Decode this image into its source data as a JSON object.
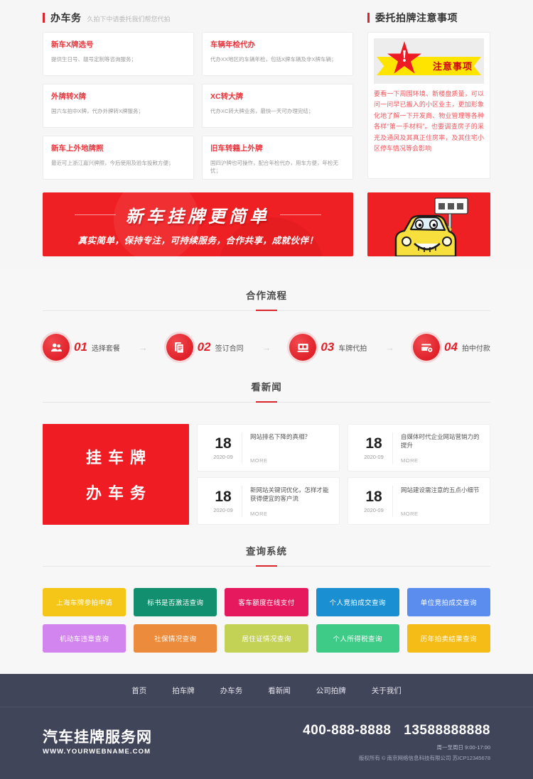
{
  "services": {
    "heading": "办车务",
    "subheading": "久拍下中请委托我们帮您代拍",
    "cards": [
      {
        "title": "新车X牌选号",
        "desc": "提供生日号、靓号定制等咨询服务；"
      },
      {
        "title": "车辆年检代办",
        "desc": "代办XX地区的车辆年检，包括X牌车辆及非X牌车辆；"
      },
      {
        "title": "外牌转X牌",
        "desc": "国六车拍中X牌，代办外牌转X牌服务；"
      },
      {
        "title": "XC转大牌",
        "desc": "代办XC转大牌业务，最快一天可办理完结；"
      },
      {
        "title": "新车上外地牌照",
        "desc": "最近可上浙江嘉兴牌照，今后使用及验车投敕方便；"
      },
      {
        "title": "旧车转籍上外牌",
        "desc": "国四沪牌也可操作，配合年检代办，用车方便，年检无忧；"
      }
    ]
  },
  "notice": {
    "heading": "委托拍牌注意事项",
    "banner_text": "注意事项",
    "banner_mark": "!",
    "body": "要看一下周围环境、新楼盘质量，可以问一问早已搬入的小区业主，更加形象化地了解一下开发商、物业管理等各种各样“第一手材料”。也要调查房子的采光及通风及其真正住房率，及其住宅小区停车情况等会影响"
  },
  "banner": {
    "title": "新车挂牌更简单",
    "subtitle": "真实简单，保持专注，可持续服务，合作共享，成就伙伴！",
    "side_icon": "cartoon-car-holding-plate"
  },
  "process": {
    "title": "合作流程",
    "arrow": "→",
    "steps": [
      {
        "num": "01",
        "label": "选择套餐",
        "icon": "users-icon"
      },
      {
        "num": "02",
        "label": "签订合同",
        "icon": "document-icon"
      },
      {
        "num": "03",
        "label": "车牌代拍",
        "icon": "license-plate-icon"
      },
      {
        "num": "04",
        "label": "拍中付款",
        "icon": "payment-card-icon"
      }
    ]
  },
  "news": {
    "title": "看新闻",
    "promo_line1": "挂车牌",
    "promo_line2": "办车务",
    "more_label": "MORE",
    "items": [
      {
        "day": "18",
        "month": "2020-09",
        "title": "网站排名下降的真相？"
      },
      {
        "day": "18",
        "month": "2020-09",
        "title": "新网站关键词优化，怎样才能获得便宜的客户流"
      },
      {
        "day": "18",
        "month": "2020-09",
        "title": "自媒体时代企业网站营销力的提升"
      },
      {
        "day": "18",
        "month": "2020-09",
        "title": "网站建设需注意的五点小细节"
      }
    ]
  },
  "query": {
    "title": "查询系统",
    "buttons": [
      {
        "label": "上海车牌参拍申请",
        "color": "#f5c518"
      },
      {
        "label": "标书是否激活查询",
        "color": "#128f6e"
      },
      {
        "label": "客车额度在线支付",
        "color": "#e6195e"
      },
      {
        "label": "个人竞拍成交查询",
        "color": "#1a8fd1"
      },
      {
        "label": "单位竞拍成交查询",
        "color": "#5b8def"
      },
      {
        "label": "机动车违章查询",
        "color": "#d284ef"
      },
      {
        "label": "社保情况查询",
        "color": "#ec8b3c"
      },
      {
        "label": "居住证情况查询",
        "color": "#c3d254"
      },
      {
        "label": "个人所得税查询",
        "color": "#3ecb87"
      },
      {
        "label": "历年拍卖结果查询",
        "color": "#f5bc18"
      }
    ]
  },
  "footer": {
    "nav": [
      "首页",
      "拍车牌",
      "办车务",
      "看新闻",
      "公司拍牌",
      "关于我们"
    ],
    "brand_name": "汽车挂牌服务网",
    "brand_url": "WWW.YOURWEBNAME.COM",
    "phone_primary": "400-888-8888",
    "phone_secondary": "13588888888",
    "hours": "周一至周日 9:00-17:00",
    "copyright": "版权所有 © 南京网络信息科技有限公司 苏ICP12345678"
  }
}
